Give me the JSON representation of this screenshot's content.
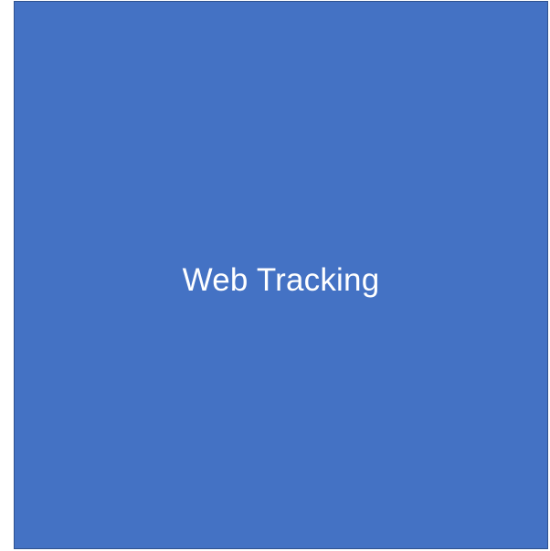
{
  "block": {
    "label": "Web Tracking",
    "fill_color": "#4472C4",
    "border_color": "#2F528F",
    "text_color": "#FFFFFF"
  }
}
